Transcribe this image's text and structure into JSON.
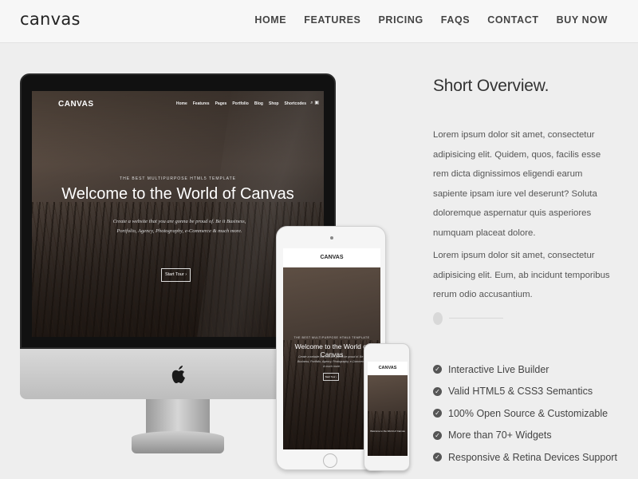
{
  "header": {
    "logo": "canvas",
    "nav": [
      "HOME",
      "FEATURES",
      "PRICING",
      "FAQS",
      "CONTACT",
      "BUY NOW"
    ]
  },
  "devices": {
    "monitor": {
      "logo": "CANVAS",
      "menu": [
        "Home",
        "Features",
        "Pages",
        "Portfolio",
        "Blog",
        "Shop",
        "Shortcodes"
      ],
      "subtitle": "THE BEST MULTIPURPOSE HTML5 TEMPLATE",
      "title": "Welcome to the World of Canvas",
      "description": "Create a website that you are gonna be proud of. Be it Business, Portfolio, Agency, Photography, e-Commerce & much more.",
      "button": "Start Tour ›"
    },
    "tablet": {
      "logo": "CANVAS",
      "subtitle": "THE BEST MULTIPURPOSE HTML5 TEMPLATE",
      "title": "Welcome to the World of Canvas",
      "description": "Create a website that you are gonna be proud of. Be it Business, Portfolio, Agency, Photography, e-Commerce & much more.",
      "button": "Start Tour ›"
    },
    "phone": {
      "logo": "CANVAS",
      "text": "Welcome to the World of Canvas"
    }
  },
  "overview": {
    "title": "Short Overview.",
    "paragraph1": "Lorem ipsum dolor sit amet, consectetur adipisicing elit. Quidem, quos, facilis esse rem dicta dignissimos eligendi earum sapiente ipsam iure vel deserunt? Soluta doloremque aspernatur quis asperiores numquam placeat dolore.",
    "paragraph2": "Lorem ipsum dolor sit amet, consectetur adipisicing elit. Eum, ab incidunt temporibus rerum odio accusantium.",
    "features": [
      "Interactive Live Builder",
      "Valid HTML5 & CSS3 Semantics",
      "100% Open Source & Customizable",
      "More than 70+ Widgets",
      "Responsive & Retina Devices Support"
    ]
  },
  "icons": {
    "check": "check-circle-icon",
    "apple": "apple-logo-icon",
    "search": "search-icon",
    "cart": "cart-icon"
  },
  "colors": {
    "background": "#eeeeee",
    "header_bg": "#f7f7f7",
    "text": "#333333"
  }
}
